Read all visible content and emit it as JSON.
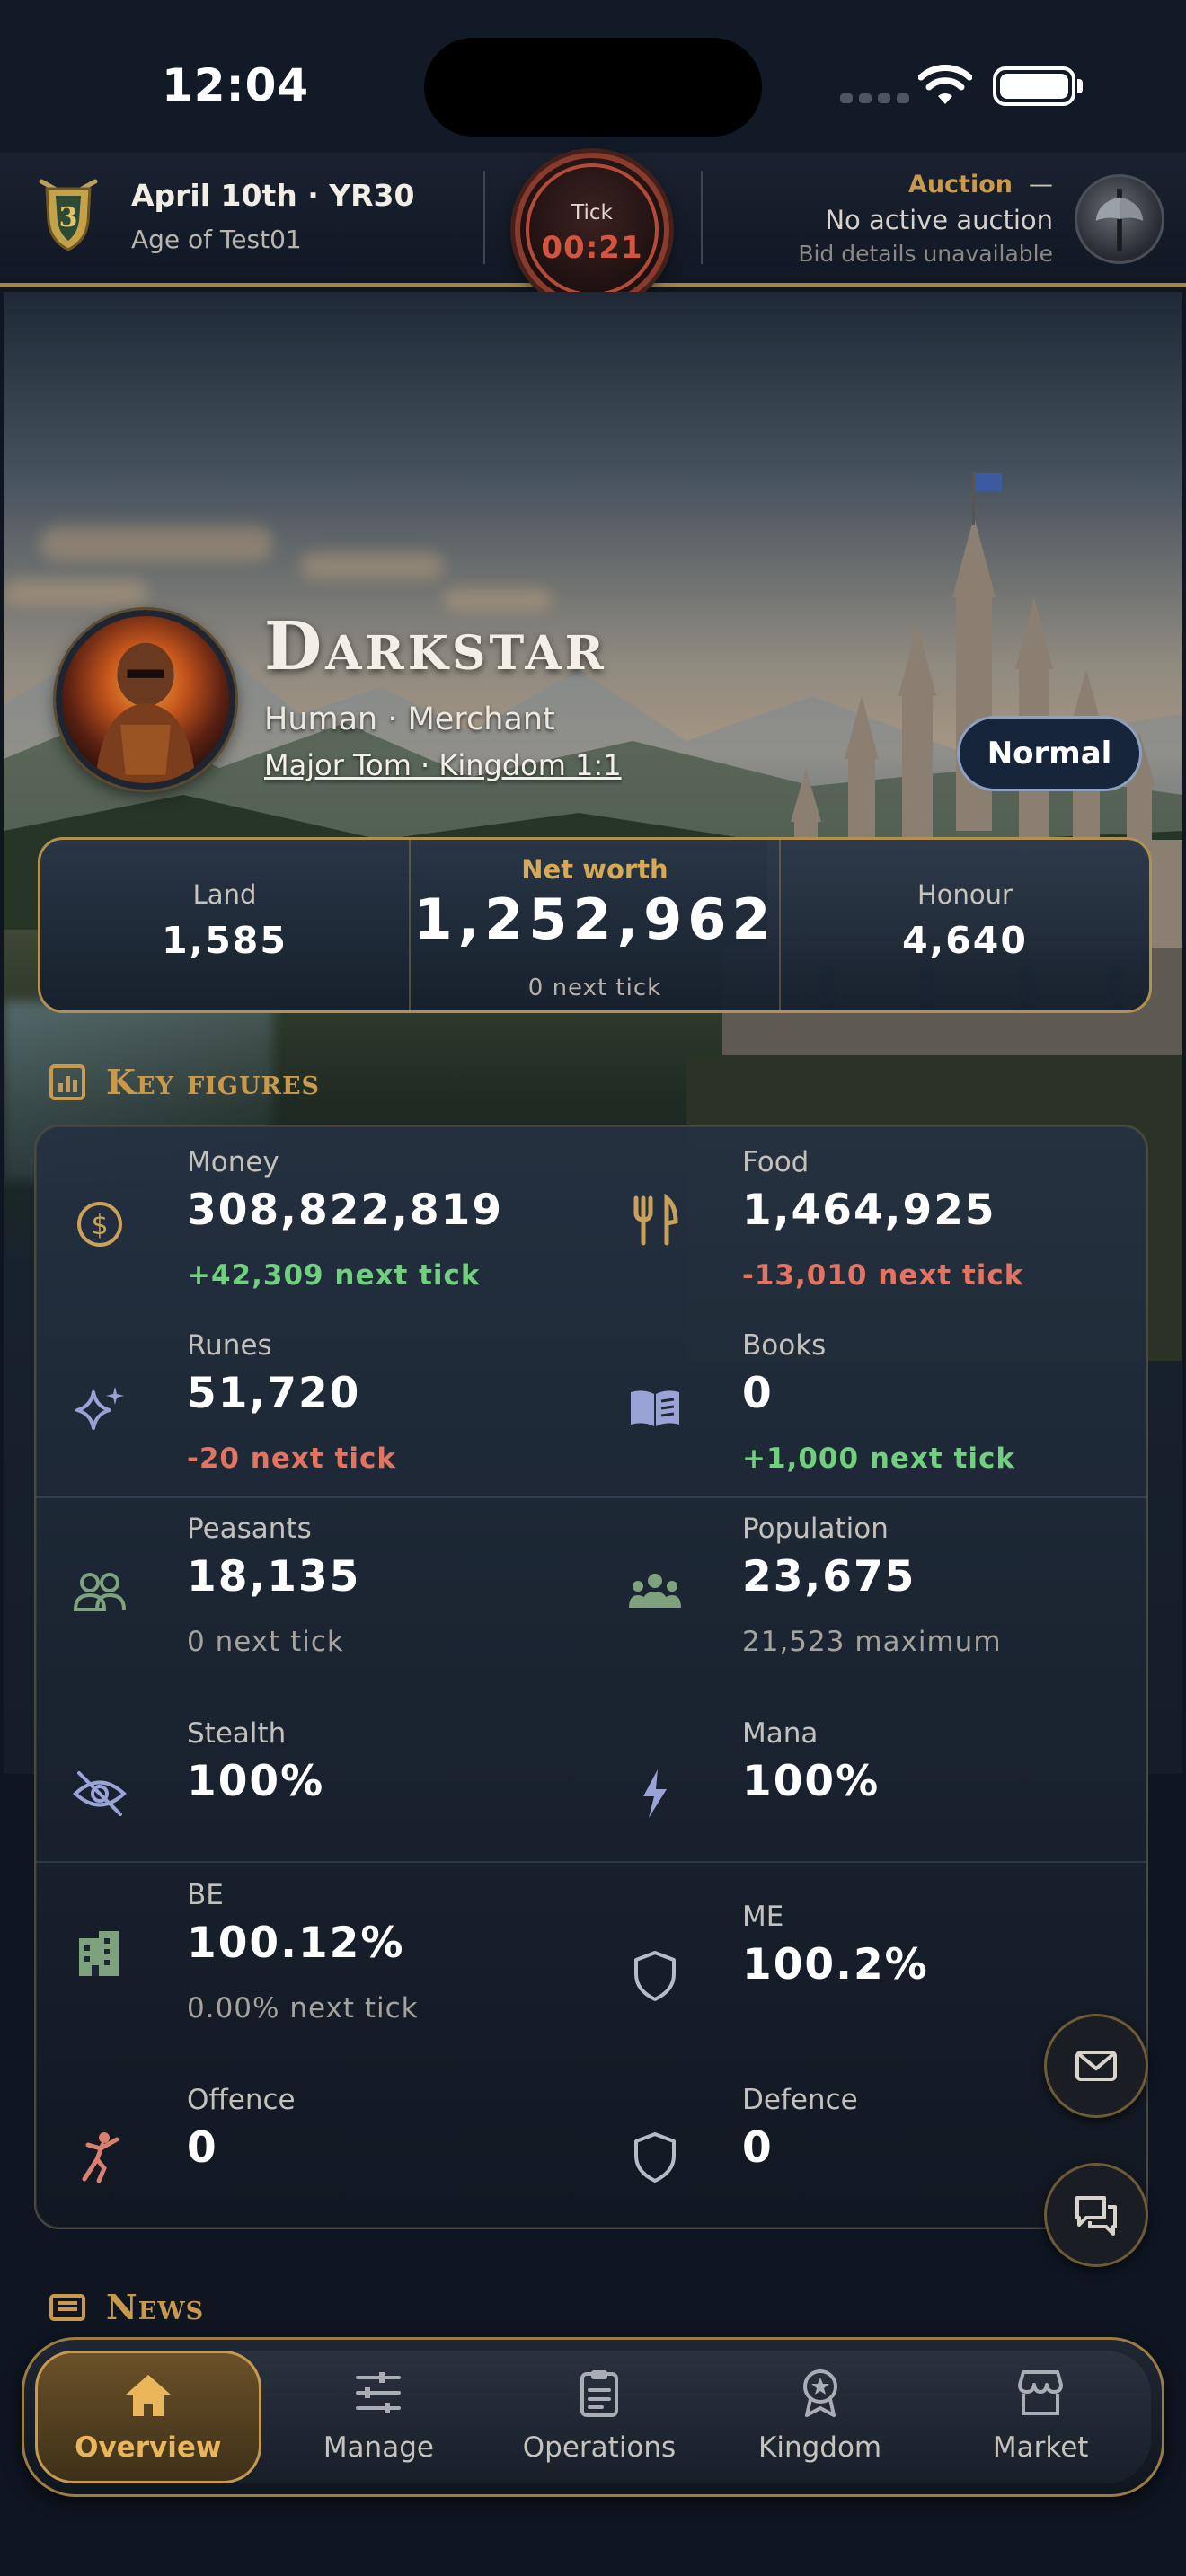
{
  "status_bar": {
    "time": "12:04"
  },
  "header": {
    "date": "April 10th · YR30",
    "age": "Age of Test01",
    "tick_label": "Tick",
    "tick_time": "00:21",
    "auction_title": "Auction",
    "auction_dash": "—",
    "auction_status": "No active auction",
    "auction_sub": "Bid details unavailable"
  },
  "profile": {
    "name": "Darkstar",
    "race_class": "Human · Merchant",
    "ruler": "Major Tom · Kingdom 1:1",
    "mode_badge": "Normal"
  },
  "stats": {
    "land_label": "Land",
    "land_value": "1,585",
    "networth_label": "Net worth",
    "networth_value": "1,252,962",
    "networth_sub": "0 next tick",
    "honour_label": "Honour",
    "honour_value": "4,640"
  },
  "key_figures": {
    "heading": "Key figures",
    "money": {
      "label": "Money",
      "value": "308,822,819",
      "change": "+42,309 next tick",
      "icon": "dollar-coin-icon"
    },
    "food": {
      "label": "Food",
      "value": "1,464,925",
      "change": "-13,010 next tick",
      "icon": "utensils-icon"
    },
    "runes": {
      "label": "Runes",
      "value": "51,720",
      "change": "-20 next tick",
      "icon": "sparkles-icon"
    },
    "books": {
      "label": "Books",
      "value": "0",
      "change": "+1,000 next tick",
      "icon": "open-book-icon"
    },
    "peasants": {
      "label": "Peasants",
      "value": "18,135",
      "change": "0 next tick",
      "icon": "two-people-icon"
    },
    "population": {
      "label": "Population",
      "value": "23,675",
      "change": "21,523 maximum",
      "icon": "group-icon"
    },
    "stealth": {
      "label": "Stealth",
      "value": "100%",
      "icon": "eye-slash-icon"
    },
    "mana": {
      "label": "Mana",
      "value": "100%",
      "icon": "lightning-icon"
    },
    "be": {
      "label": "BE",
      "value": "100.12%",
      "change": "0.00% next tick",
      "icon": "building-icon"
    },
    "me": {
      "label": "ME",
      "value": "100.2%",
      "icon": "shield-icon"
    },
    "offence": {
      "label": "Offence",
      "value": "0",
      "icon": "martial-arts-icon"
    },
    "defence": {
      "label": "Defence",
      "value": "0",
      "icon": "shield-icon"
    }
  },
  "news": {
    "heading": "News"
  },
  "nav": [
    {
      "label": "Overview",
      "icon": "home-icon"
    },
    {
      "label": "Manage",
      "icon": "sliders-icon"
    },
    {
      "label": "Operations",
      "icon": "clipboard-icon"
    },
    {
      "label": "Kingdom",
      "icon": "award-badge-icon"
    },
    {
      "label": "Market",
      "icon": "storefront-icon"
    }
  ],
  "colors": {
    "accent_gold": "#c99a4c",
    "positive": "#71d07d",
    "negative": "#e37462",
    "tick_red": "#d4553f"
  }
}
